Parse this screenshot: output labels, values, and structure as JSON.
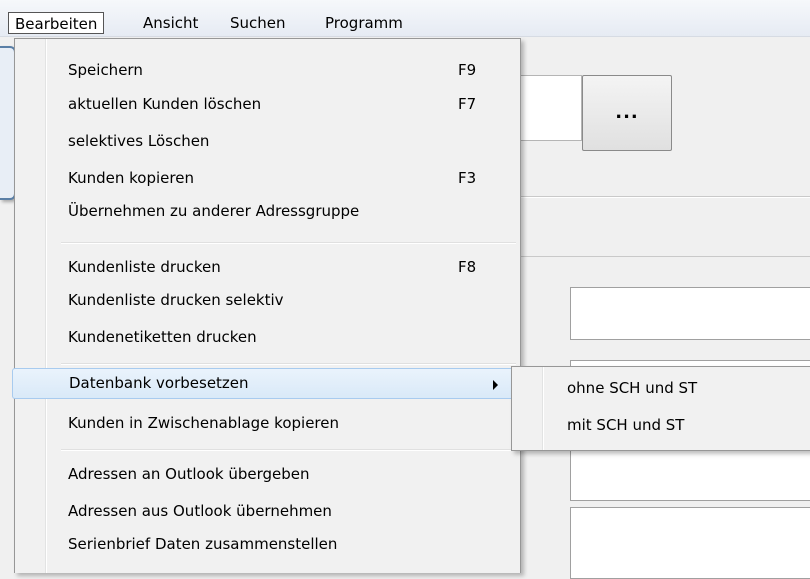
{
  "menubar": {
    "items": [
      {
        "label": "Bearbeiten"
      },
      {
        "label": "Ansicht"
      },
      {
        "label": "Suchen"
      },
      {
        "label": "Programm"
      }
    ]
  },
  "background": {
    "button_label": "..."
  },
  "menu": {
    "group1": [
      {
        "label": "Speichern",
        "shortcut": "F9"
      },
      {
        "label": "aktuellen Kunden löschen",
        "shortcut": "F7"
      },
      {
        "label": "selektives Löschen",
        "shortcut": ""
      },
      {
        "label": "Kunden kopieren",
        "shortcut": "F3"
      },
      {
        "label": "Übernehmen zu anderer Adressgruppe",
        "shortcut": ""
      }
    ],
    "group2": [
      {
        "label": "Kundenliste drucken",
        "shortcut": "F8"
      },
      {
        "label": "Kundenliste drucken selektiv",
        "shortcut": ""
      },
      {
        "label": "Kundenetiketten drucken",
        "shortcut": ""
      }
    ],
    "group3": [
      {
        "label": "Datenbank vorbesetzen",
        "shortcut": ""
      },
      {
        "label": "Kunden in Zwischenablage kopieren",
        "shortcut": ""
      }
    ],
    "group4": [
      {
        "label": "Adressen an Outlook übergeben",
        "shortcut": ""
      },
      {
        "label": "Adressen aus Outlook übernehmen",
        "shortcut": ""
      },
      {
        "label": "Serienbrief Daten zusammenstellen",
        "shortcut": ""
      }
    ]
  },
  "submenu": {
    "items": [
      {
        "label": "ohne SCH und ST"
      },
      {
        "label": "mit SCH und ST"
      }
    ]
  }
}
